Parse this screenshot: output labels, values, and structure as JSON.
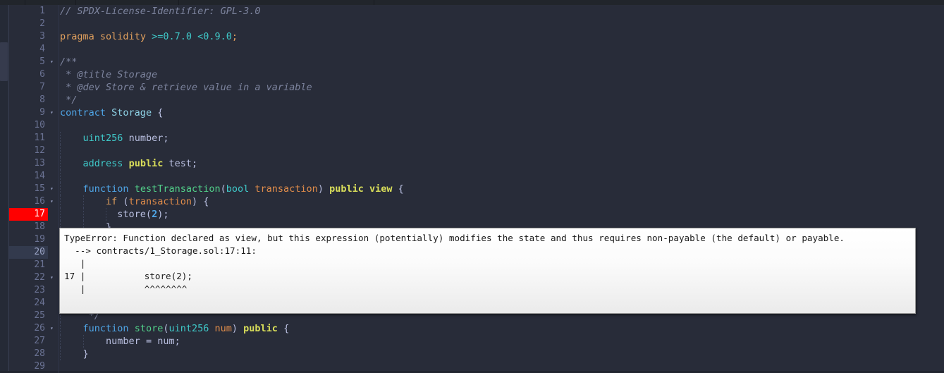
{
  "app": {
    "theme_bg": "#282c39",
    "gutter_color": "#6b7394",
    "error_marker_color": "#ff0000",
    "current_line_color": "#333a4d"
  },
  "editor": {
    "first_line": 1,
    "last_line": 29,
    "error_line": 17,
    "current_line": 20,
    "fold_lines": [
      5,
      9,
      15,
      16,
      22,
      26
    ],
    "fold_glyph": "▾",
    "lines": [
      {
        "n": 1,
        "indent": 0,
        "tokens": [
          {
            "t": "// SPDX-License-Identifier: GPL-3.0",
            "c": "cmt"
          }
        ]
      },
      {
        "n": 2,
        "indent": 0,
        "tokens": []
      },
      {
        "n": 3,
        "indent": 0,
        "tokens": [
          {
            "t": "pragma",
            "c": "kw2"
          },
          {
            "t": " ",
            "c": "op"
          },
          {
            "t": "solidity",
            "c": "kw2"
          },
          {
            "t": " ",
            "c": "op"
          },
          {
            "t": ">=0.7.0 <0.9.0",
            "c": "typ"
          },
          {
            "t": ";",
            "c": "kw2"
          }
        ]
      },
      {
        "n": 4,
        "indent": 0,
        "tokens": []
      },
      {
        "n": 5,
        "indent": 0,
        "tokens": [
          {
            "t": "/**",
            "c": "cmt"
          }
        ]
      },
      {
        "n": 6,
        "indent": 0,
        "tokens": [
          {
            "t": " * @title Storage",
            "c": "cmt"
          }
        ]
      },
      {
        "n": 7,
        "indent": 0,
        "tokens": [
          {
            "t": " * @dev Store & retrieve value in a variable",
            "c": "cmt"
          }
        ]
      },
      {
        "n": 8,
        "indent": 0,
        "tokens": [
          {
            "t": " */",
            "c": "cmt"
          }
        ]
      },
      {
        "n": 9,
        "indent": 0,
        "tokens": [
          {
            "t": "contract",
            "c": "kw"
          },
          {
            "t": " ",
            "c": "op"
          },
          {
            "t": "Storage",
            "c": "cls"
          },
          {
            "t": " {",
            "c": "op"
          }
        ]
      },
      {
        "n": 10,
        "indent": 0,
        "tokens": []
      },
      {
        "n": 11,
        "indent": 1,
        "tokens": [
          {
            "t": "    ",
            "c": "op"
          },
          {
            "t": "uint256",
            "c": "typ"
          },
          {
            "t": " ",
            "c": "op"
          },
          {
            "t": "number",
            "c": "id"
          },
          {
            "t": ";",
            "c": "op"
          }
        ]
      },
      {
        "n": 12,
        "indent": 1,
        "tokens": []
      },
      {
        "n": 13,
        "indent": 1,
        "tokens": [
          {
            "t": "    ",
            "c": "op"
          },
          {
            "t": "address",
            "c": "typ"
          },
          {
            "t": " ",
            "c": "op"
          },
          {
            "t": "public",
            "c": "mod"
          },
          {
            "t": " ",
            "c": "op"
          },
          {
            "t": "test",
            "c": "id"
          },
          {
            "t": ";",
            "c": "op"
          }
        ]
      },
      {
        "n": 14,
        "indent": 1,
        "tokens": []
      },
      {
        "n": 15,
        "indent": 1,
        "tokens": [
          {
            "t": "    ",
            "c": "op"
          },
          {
            "t": "function",
            "c": "kw"
          },
          {
            "t": " ",
            "c": "op"
          },
          {
            "t": "testTransaction",
            "c": "fn"
          },
          {
            "t": "(",
            "c": "op"
          },
          {
            "t": "bool",
            "c": "typ"
          },
          {
            "t": " ",
            "c": "op"
          },
          {
            "t": "transaction",
            "c": "par"
          },
          {
            "t": ") ",
            "c": "op"
          },
          {
            "t": "public",
            "c": "mod"
          },
          {
            "t": " ",
            "c": "op"
          },
          {
            "t": "view",
            "c": "mod"
          },
          {
            "t": " {",
            "c": "op"
          }
        ]
      },
      {
        "n": 16,
        "indent": 2,
        "tokens": [
          {
            "t": "        ",
            "c": "op"
          },
          {
            "t": "if",
            "c": "kw2"
          },
          {
            "t": " (",
            "c": "op"
          },
          {
            "t": "transaction",
            "c": "par"
          },
          {
            "t": ") {",
            "c": "op"
          }
        ]
      },
      {
        "n": 17,
        "indent": 3,
        "tokens": [
          {
            "t": "          ",
            "c": "op"
          },
          {
            "t": "store",
            "c": "id"
          },
          {
            "t": "(",
            "c": "op"
          },
          {
            "t": "2",
            "c": "num"
          },
          {
            "t": ");",
            "c": "op"
          }
        ]
      },
      {
        "n": 18,
        "indent": 2,
        "tokens": [
          {
            "t": "        }",
            "c": "op"
          }
        ]
      },
      {
        "n": 19,
        "indent": 1,
        "tokens": []
      },
      {
        "n": 20,
        "indent": 1,
        "tokens": []
      },
      {
        "n": 21,
        "indent": 1,
        "tokens": []
      },
      {
        "n": 22,
        "indent": 1,
        "tokens": []
      },
      {
        "n": 23,
        "indent": 1,
        "tokens": []
      },
      {
        "n": 24,
        "indent": 1,
        "tokens": []
      },
      {
        "n": 25,
        "indent": 1,
        "tokens": [
          {
            "t": "     */",
            "c": "cmt"
          }
        ]
      },
      {
        "n": 26,
        "indent": 1,
        "tokens": [
          {
            "t": "    ",
            "c": "op"
          },
          {
            "t": "function",
            "c": "kw"
          },
          {
            "t": " ",
            "c": "op"
          },
          {
            "t": "store",
            "c": "fn"
          },
          {
            "t": "(",
            "c": "op"
          },
          {
            "t": "uint256",
            "c": "typ"
          },
          {
            "t": " ",
            "c": "op"
          },
          {
            "t": "num",
            "c": "par"
          },
          {
            "t": ") ",
            "c": "op"
          },
          {
            "t": "public",
            "c": "mod"
          },
          {
            "t": " {",
            "c": "op"
          }
        ]
      },
      {
        "n": 27,
        "indent": 2,
        "tokens": [
          {
            "t": "        ",
            "c": "op"
          },
          {
            "t": "number",
            "c": "id"
          },
          {
            "t": " = ",
            "c": "op"
          },
          {
            "t": "num",
            "c": "id"
          },
          {
            "t": ";",
            "c": "op"
          }
        ]
      },
      {
        "n": 28,
        "indent": 1,
        "tokens": [
          {
            "t": "    }",
            "c": "op"
          }
        ]
      },
      {
        "n": 29,
        "indent": 0,
        "tokens": []
      }
    ]
  },
  "error_tooltip": {
    "text": "TypeError: Function declared as view, but this expression (potentially) modifies the state and thus requires non-payable (the default) or payable.\n  --> contracts/1_Storage.sol:17:11:\n   |\n17 |           store(2);\n   |           ^^^^^^^^\n"
  }
}
